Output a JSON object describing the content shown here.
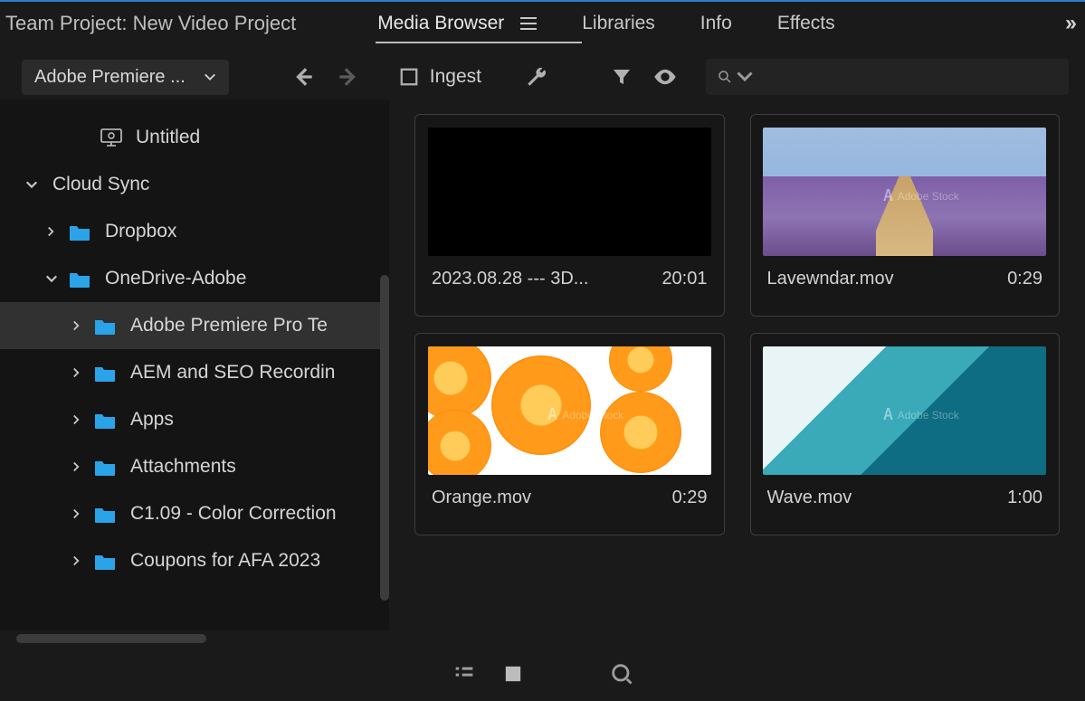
{
  "project_title": "Team Project: New Video Project",
  "tabs": {
    "media_browser": "Media Browser",
    "libraries": "Libraries",
    "info": "Info",
    "effects": "Effects"
  },
  "toolbar": {
    "source_label": "Adobe Premiere ...",
    "ingest_label": "Ingest"
  },
  "sidebar": {
    "untitled": "Untitled",
    "cloud_sync": "Cloud Sync",
    "dropbox": "Dropbox",
    "onedrive": "OneDrive-Adobe",
    "items": [
      "Adobe Premiere Pro Te",
      "AEM and SEO Recordin",
      "Apps",
      "Attachments",
      "C1.09 - Color Correction",
      "Coupons for AFA 2023"
    ]
  },
  "clips": [
    {
      "name": "2023.08.28 --- 3D...",
      "duration": "20:01",
      "style": "black"
    },
    {
      "name": "Lavewndar.mov",
      "duration": "0:29",
      "style": "lavender"
    },
    {
      "name": "Orange.mov",
      "duration": "0:29",
      "style": "orange"
    },
    {
      "name": "Wave.mov",
      "duration": "1:00",
      "style": "wave"
    }
  ],
  "watermark": "Adobe Stock"
}
